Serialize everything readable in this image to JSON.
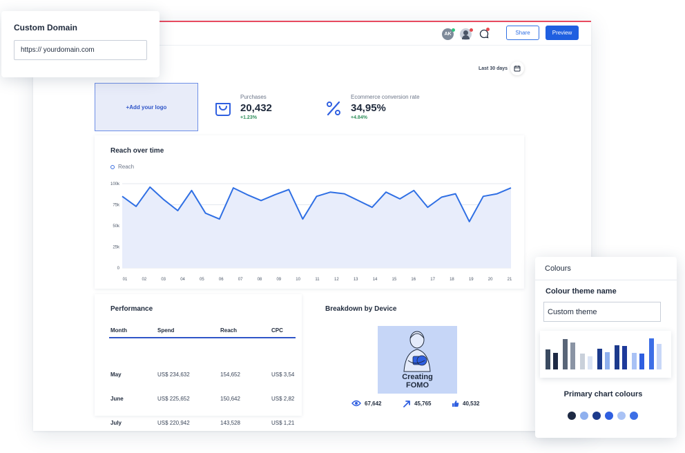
{
  "header": {
    "avatar_initials": "AK",
    "share_label": "Share",
    "preview_label": "Preview",
    "date_range": "Last 30 days"
  },
  "logo_placeholder": "+Add your logo",
  "kpis": [
    {
      "label": "Purchases",
      "value": "20,432",
      "change": "+1.23%",
      "icon": "shopping-bag-icon"
    },
    {
      "label": "Ecommerce conversion rate",
      "value": "34,95%",
      "change": "+4.84%",
      "icon": "percent-icon"
    }
  ],
  "reach_chart": {
    "title": "Reach over time",
    "legend": "Reach"
  },
  "chart_data": {
    "type": "area",
    "title": "Reach over time",
    "series": [
      {
        "name": "Reach",
        "values": [
          85,
          73,
          96,
          81,
          68,
          92,
          65,
          58,
          95,
          87,
          80,
          87,
          93,
          58,
          85,
          90,
          88,
          80,
          72,
          90,
          82,
          92,
          72,
          84,
          88,
          55,
          85,
          88,
          95
        ]
      }
    ],
    "x_ticks": [
      "01",
      "02",
      "03",
      "04",
      "05",
      "06",
      "07",
      "08",
      "09",
      "10",
      "11",
      "12",
      "13",
      "14",
      "15",
      "16",
      "17",
      "18",
      "19",
      "20",
      "21"
    ],
    "y_ticks": [
      "100k",
      "75k",
      "50k",
      "25k",
      "0"
    ],
    "ylim": [
      0,
      100
    ],
    "grid": true,
    "fill_color": "#e8edfb",
    "line_color": "#2f6fe4"
  },
  "performance": {
    "title": "Performance",
    "columns": [
      "Month",
      "Spend",
      "Reach",
      "CPC"
    ],
    "rows": [
      [
        "May",
        "US$ 234,632",
        "154,652",
        "US$ 3,54"
      ],
      [
        "June",
        "US$ 225,652",
        "150,642",
        "US$ 2,82"
      ],
      [
        "July",
        "US$ 220,942",
        "143,528",
        "US$ 1,21"
      ]
    ]
  },
  "device": {
    "title": "Breakdown by Device",
    "image_text_1": "Creating",
    "image_text_2": "FOMO",
    "stats": [
      {
        "icon": "eye-icon",
        "value": "67,642"
      },
      {
        "icon": "arrow-icon",
        "value": "45,765"
      },
      {
        "icon": "thumbs-up-icon",
        "value": "40,532"
      }
    ]
  },
  "custom_domain": {
    "title": "Custom Domain",
    "value": "https:// yourdomain.com"
  },
  "colours": {
    "header": "Colours",
    "theme_label": "Colour theme name",
    "theme_value": "Custom theme",
    "primary_label": "Primary chart colours",
    "swatches": [
      "#1e2a44",
      "#8fb0ee",
      "#1c3a8c",
      "#2f5fe0",
      "#a9c2f5",
      "#3d6fe6"
    ],
    "bar_colors": [
      "#3a4a60",
      "#1e2a44",
      "#5a6678",
      "#8a94a4",
      "#c9d0da",
      "#dbe4f5",
      "#1c3a8c",
      "#8fb0ee",
      "#1c3a8c",
      "#1e3a9a",
      "#a9c2f5",
      "#2f5fe0",
      "#3d6fe6",
      "#c8d7f7"
    ],
    "bar_levels": [
      0.64,
      0.53,
      0.96,
      0.85,
      0.5,
      0.42,
      0.66,
      0.54,
      0.76,
      0.74,
      0.53,
      0.5,
      0.97,
      0.81
    ]
  }
}
